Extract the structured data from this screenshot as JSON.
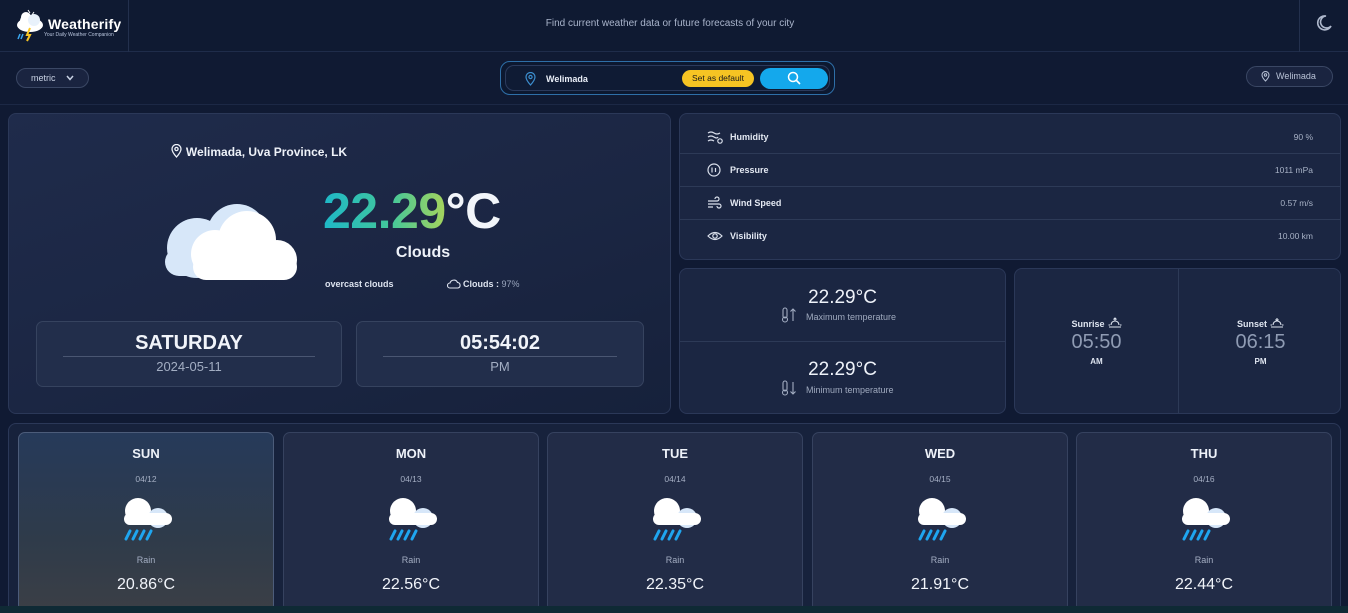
{
  "app": {
    "name": "Weatherify",
    "subtitle": "Your Daily Weather Companion",
    "tagline": "Find current weather data or future forecasts of your city",
    "theme_icon": "moon-icon"
  },
  "toolbar": {
    "unit": "metric",
    "search_value": "Welimada",
    "set_default_label": "Set as default",
    "search_icon": "search-icon",
    "saved_location": "Welimada"
  },
  "current": {
    "location": "Welimada, Uva Province, LK",
    "temp_value": "22.29",
    "temp_unit": "°C",
    "condition": "Clouds",
    "description": "overcast clouds",
    "clouds_label": "Clouds :",
    "clouds_value": "97%",
    "day": "SATURDAY",
    "date": "2024-05-11",
    "time": "05:54:02",
    "ampm": "PM"
  },
  "stats": [
    {
      "label": "Humidity",
      "value": "90 %",
      "icon": "humidity-icon"
    },
    {
      "label": "Pressure",
      "value": "1011 mPa",
      "icon": "pressure-icon"
    },
    {
      "label": "Wind Speed",
      "value": "0.57 m/s",
      "icon": "wind-icon"
    },
    {
      "label": "Visibility",
      "value": "10.00 km",
      "icon": "eye-icon"
    }
  ],
  "temps": {
    "max_value": "22.29°C",
    "max_label": "Maximum temperature",
    "min_value": "22.29°C",
    "min_label": "Minimum temperature"
  },
  "sun": {
    "sunrise_label": "Sunrise",
    "sunrise_time": "05:50",
    "sunrise_ampm": "AM",
    "sunset_label": "Sunset",
    "sunset_time": "06:15",
    "sunset_ampm": "PM"
  },
  "forecast": [
    {
      "day": "SUN",
      "date": "04/12",
      "condition": "Rain",
      "temp": "20.86°C"
    },
    {
      "day": "MON",
      "date": "04/13",
      "condition": "Rain",
      "temp": "22.56°C"
    },
    {
      "day": "TUE",
      "date": "04/14",
      "condition": "Rain",
      "temp": "22.35°C"
    },
    {
      "day": "WED",
      "date": "04/15",
      "condition": "Rain",
      "temp": "21.91°C"
    },
    {
      "day": "THU",
      "date": "04/16",
      "condition": "Rain",
      "temp": "22.44°C"
    }
  ],
  "colors": {
    "background": "#101a33",
    "accent": "#14a8ec",
    "default_button": "#f6c423",
    "temp_gradient_start": "#1eb8c8",
    "temp_gradient_end": "#a6d45c"
  }
}
